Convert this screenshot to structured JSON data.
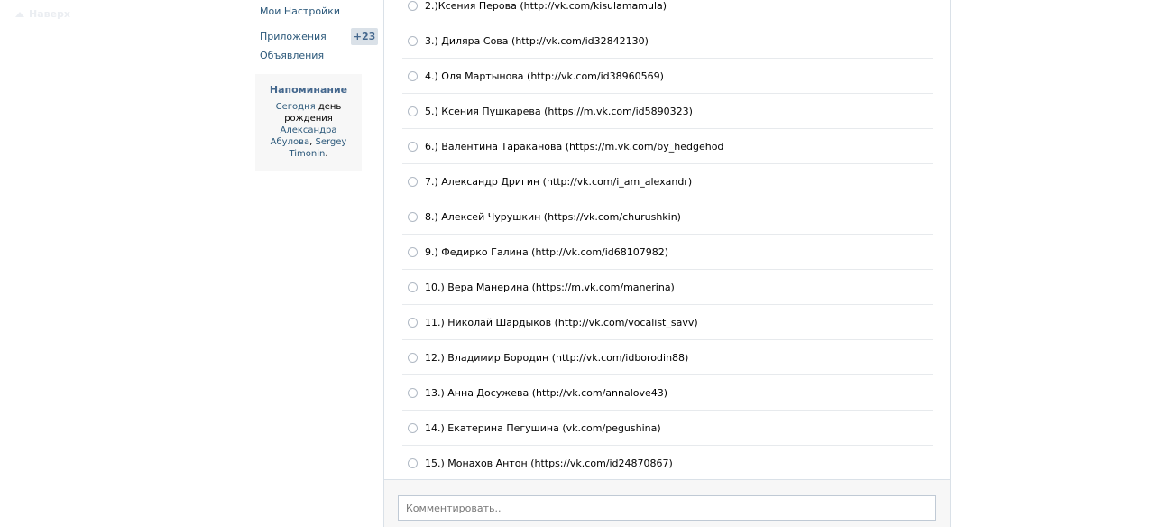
{
  "nav": {
    "back_to_top": "Наверх"
  },
  "menu": {
    "settings": "Мои Настройки",
    "apps": "Приложения",
    "apps_badge": "+23",
    "ads": "Объявления"
  },
  "reminder": {
    "title": "Напоминание",
    "today": "Сегодня",
    "text1": " день рождения ",
    "person1": "Александра Абулова",
    "sep": ", ",
    "person2": "Sergey Timonin",
    "end": "."
  },
  "poll": {
    "options": [
      "2.)Ксения Перова (http://vk.com/kisulamamula)",
      "3.) Диляра Сова (http://vk.com/id32842130)",
      "4.) Оля Мартынова (http://vk.com/id38960569)",
      "5.) Ксения Пушкарева (https://m.vk.com/id5890323)",
      "6.) Валентина Тараканова (https://m.vk.com/by_hedgehod",
      "7.) Александр Дригин (http://vk.com/i_am_alexandr)",
      "8.) Алексей Чурушкин (https://vk.com/churushkin)",
      "9.) Федирко Галина (http://vk.com/id68107982)",
      "10.) Вера Манерина (https://m.vk.com/manerina)",
      "11.) Николай Шардыков (http://vk.com/vocalist_savv)",
      "12.) Владимир Бородин (http://vk.com/idborodin88)",
      "13.) Анна Досужева (http://vk.com/annalove43)",
      "14.) Екатерина Пегушина (vk.com/pegushina)",
      "15.) Монахов Антон (https://vk.com/id24870867)"
    ]
  },
  "comment": {
    "placeholder": "Комментировать.."
  }
}
